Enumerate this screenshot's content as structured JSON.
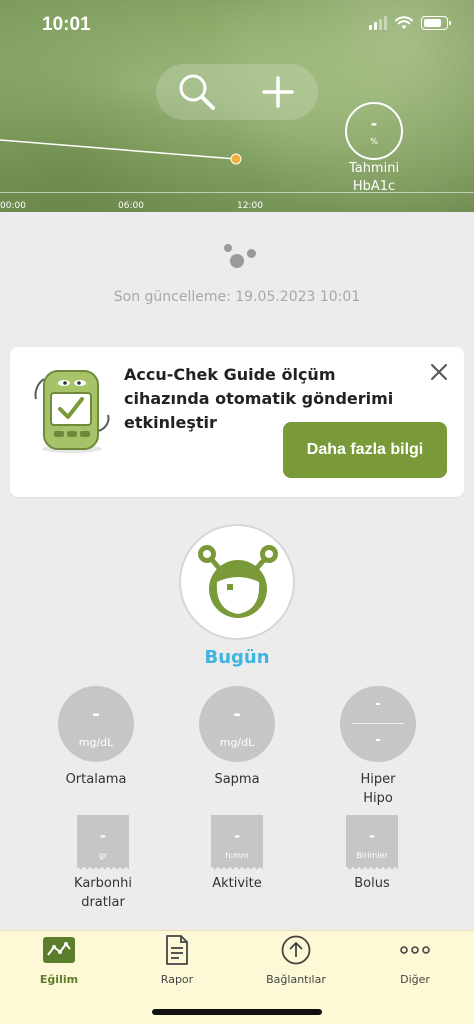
{
  "status_bar": {
    "time": "10:01"
  },
  "header": {
    "hba1c_value": "-",
    "hba1c_unit": "%",
    "hba1c_label_line1": "Tahmini",
    "hba1c_label_line2": "HbA1c",
    "time_ticks": [
      "00:00",
      "06:00",
      "12:00"
    ]
  },
  "last_update": "Son güncelleme: 19.05.2023 10:01",
  "promo_card": {
    "title": "Accu-Chek Guide ölçüm cihazında otomatik gönderimi etkinleştir",
    "cta_label": "Daha fazla bilgi"
  },
  "today": {
    "label": "Bugün"
  },
  "stats": {
    "average": {
      "value": "-",
      "unit": "mg/dL",
      "label": "Ortalama"
    },
    "deviation": {
      "value": "-",
      "unit": "mg/dL",
      "label": "Sapma"
    },
    "hyper_hypo": {
      "hyper_value": "-",
      "hypo_value": "-",
      "label_line1": "Hiper",
      "label_line2": "Hipo"
    },
    "carbs": {
      "value": "-",
      "unit": "gr",
      "label_line1": "Karbonhi",
      "label_line2": "dratlar"
    },
    "activity": {
      "value": "-",
      "unit": "h:mm",
      "label": "Aktivite"
    },
    "bolus": {
      "value": "-",
      "unit": "Birimler",
      "label": "Bolus"
    }
  },
  "tabs": [
    {
      "label": "Eğilim",
      "icon": "trend-icon",
      "active": true
    },
    {
      "label": "Rapor",
      "icon": "report-icon",
      "active": false
    },
    {
      "label": "Bağlantılar",
      "icon": "upload-icon",
      "active": false
    },
    {
      "label": "Diğer",
      "icon": "more-icon",
      "active": false
    }
  ],
  "colors": {
    "accent_green": "#7a9a3a",
    "today_blue": "#40b4e0",
    "tab_bg": "#fdf9d6",
    "glucose_dot": "#f0b040"
  }
}
